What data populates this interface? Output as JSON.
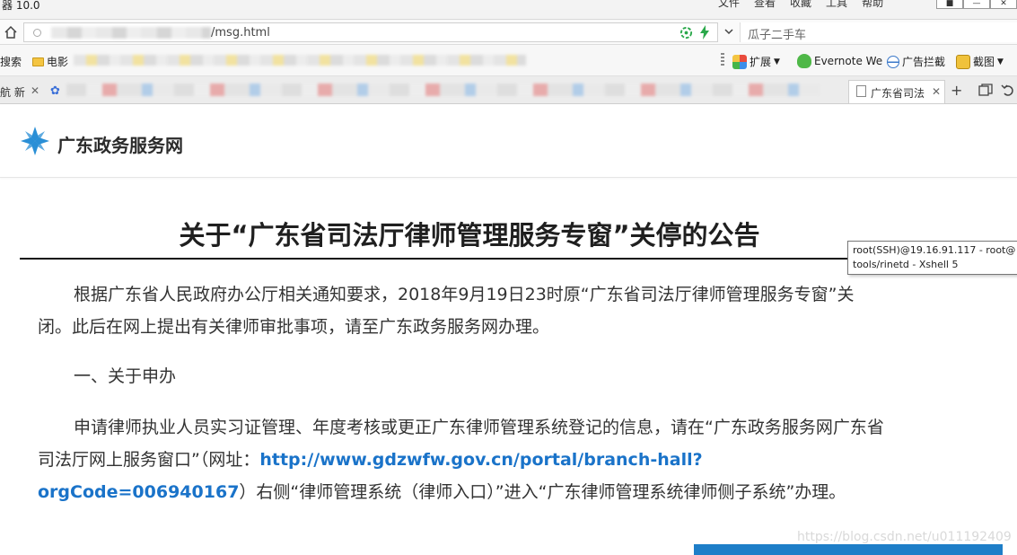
{
  "browser": {
    "window_title": "器 10.0",
    "menus": [
      "文件",
      "查看",
      "收藏",
      "工具",
      "帮助"
    ],
    "window_buttons": [
      "■",
      "—",
      "✕"
    ],
    "url": "/msg.html",
    "search_placeholder": "瓜子二手车",
    "bookmarks": {
      "search": "搜索",
      "movies": "电影",
      "extensions": "扩展",
      "evernote": "Evernote We",
      "adblock": "广告拦截",
      "screenshot": "截图"
    },
    "tabs": {
      "first_tab": "航 新",
      "active_tab": "广东省司法"
    }
  },
  "site": {
    "name": "广东政务服务网"
  },
  "article": {
    "title": "关于“广东省司法厅律师管理服务专窗”关停的公告",
    "p1": "根据广东省人民政府办公厅相关通知要求，2018年9月19日23时原“广东省司法厅律师管理服务专窗”关闭。此后在网上提出有关律师审批事项，请至广东政务服务网办理。",
    "p2": "一、关于申办",
    "p3_before": "申请律师执业人员实习证管理、年度考核或更正广东律师管理系统登记的信息，请在“广东政务服务网广东省司法厅网上服务窗口”（网址：",
    "p3_link": "http://www.gdzwfw.gov.cn/portal/branch-hall?orgCode=006940167",
    "p3_after": "）右侧“律师管理系统（律师入口）”进入“广东律师管理系统律师侧子系统”办理。"
  },
  "tooltip": {
    "line1": "root(SSH)@19.16.91.117 - root@",
    "line2": "tools/rinetd - Xshell 5"
  },
  "watermark": "https://blog.csdn.net/u011192409",
  "colors": {
    "link": "#1a73c9",
    "logo": "#2a8fd6",
    "bar": "#1e7ec8"
  }
}
